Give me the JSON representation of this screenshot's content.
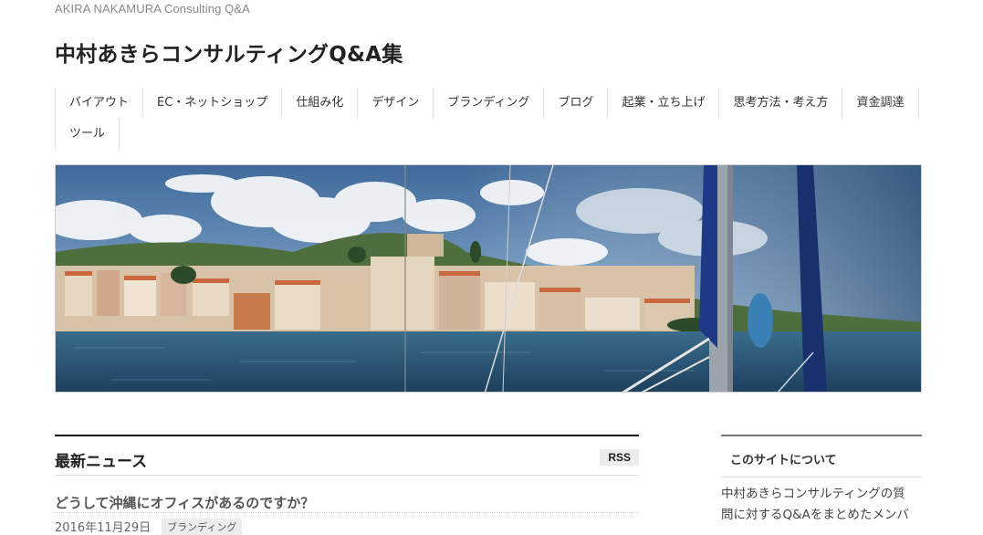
{
  "header": {
    "tagline": "AKIRA NAKAMURA Consulting Q&A",
    "site_title": "中村あきらコンサルティングQ&A集"
  },
  "nav": {
    "row1": [
      "バイアウト",
      "EC・ネットショップ",
      "仕組み化",
      "デザイン",
      "ブランディング",
      "ブログ",
      "起業・立ち上げ",
      "思考方法・考え方",
      "資金調達"
    ],
    "row2": [
      "ツール"
    ]
  },
  "hero": {
    "alt_description": "header-image"
  },
  "main": {
    "section_title": "最新ニュース",
    "rss_label": "RSS",
    "posts": [
      {
        "title": "どうして沖縄にオフィスがあるのですか？",
        "date": "2016年11月29日",
        "category": "ブランディング"
      }
    ]
  },
  "sidebar": {
    "title": "このサイトについて",
    "text_line1": "中村あきらコンサルティングの質",
    "text_line2": "問に対するQ&Aをまとめたメンバ"
  },
  "colors": {
    "accent_dark": "#111111",
    "badge_bg": "#ececec",
    "nav_border": "#e3e3e3"
  }
}
